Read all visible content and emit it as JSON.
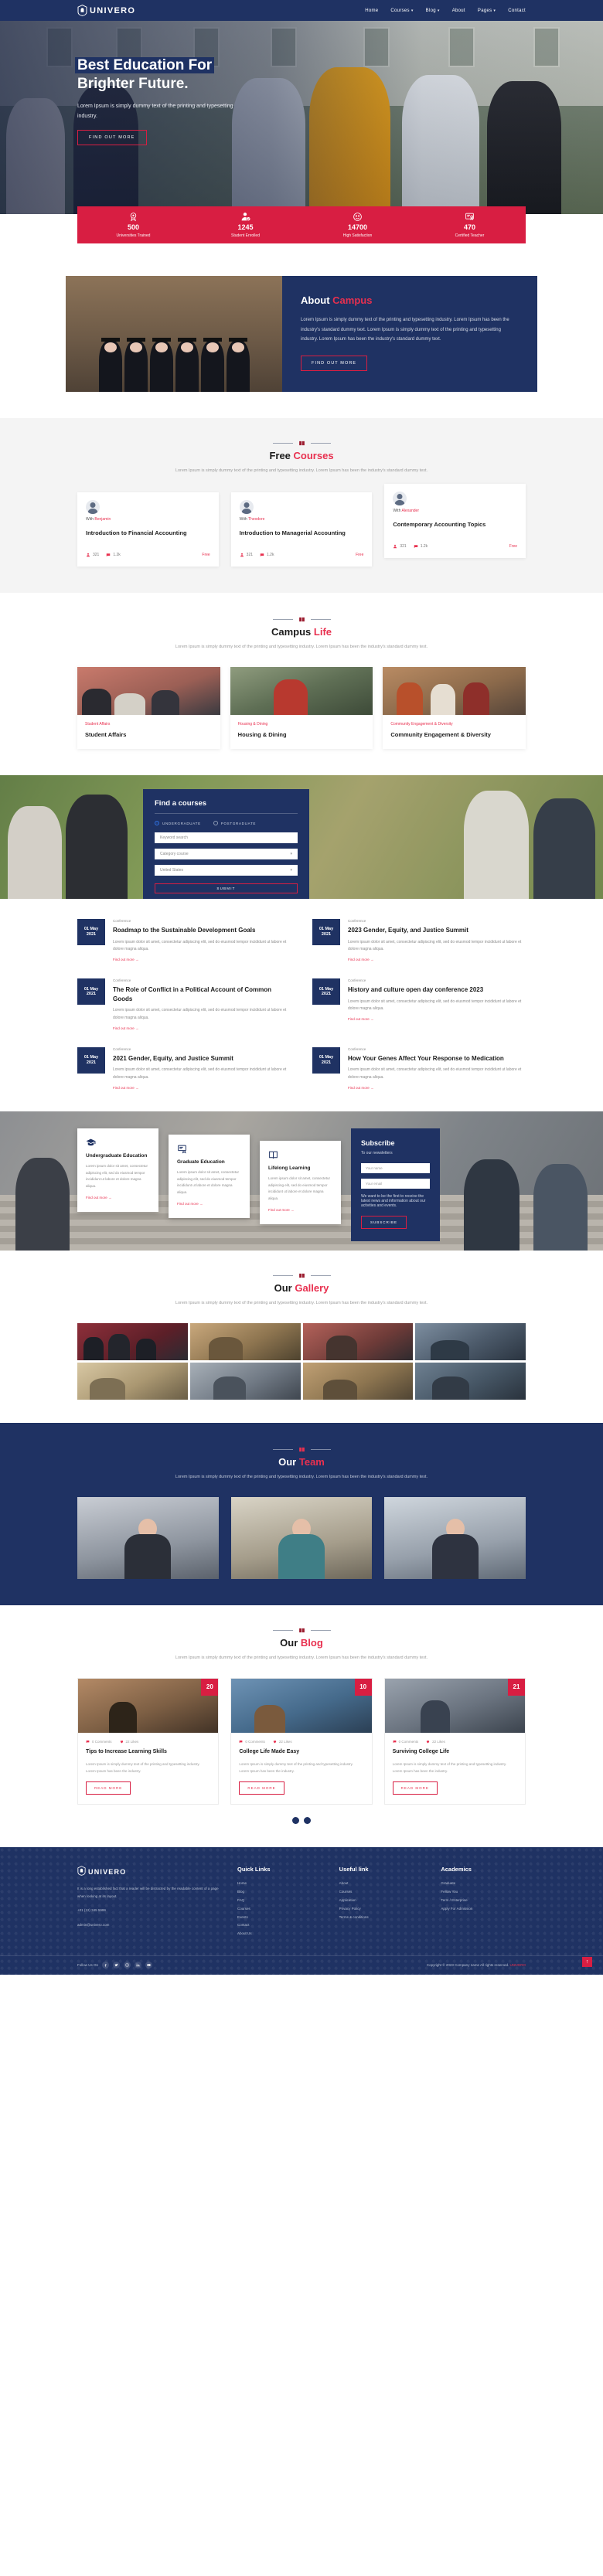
{
  "nav": {
    "brand": "UNIVERO",
    "links": [
      {
        "label": "Home",
        "caret": false
      },
      {
        "label": "Courses",
        "caret": true
      },
      {
        "label": "Blog",
        "caret": true
      },
      {
        "label": "About",
        "caret": false
      },
      {
        "label": "Pages",
        "caret": true
      },
      {
        "label": "Contact",
        "caret": false
      }
    ]
  },
  "hero": {
    "line1": "Best Education For",
    "line2": "Brighter Future.",
    "paragraph": "Lorem Ipsum is simply dummy text of the printing and typesetting industry.",
    "button": "FIND OUT MORE"
  },
  "stats": [
    {
      "icon": "award-badge-icon",
      "number": "500",
      "label": "Universities Trained"
    },
    {
      "icon": "verified-student-icon",
      "number": "1245",
      "label": "Student Enrolled"
    },
    {
      "icon": "smile-face-icon",
      "number": "14700",
      "label": "High Satisfaction"
    },
    {
      "icon": "certificate-icon",
      "number": "470",
      "label": "Certified Teacher"
    }
  ],
  "about": {
    "title_main": "About",
    "title_accent": "Campus",
    "paragraph": "Lorem Ipsum is simply dummy text of the printing and typesetting industry. Lorem Ipsum has been the industry's standard dummy text. Lorem Ipsum is simply dummy text of the printing and typesetting industry. Lorem Ipsum has been the industry's standard dummy text.",
    "button": "FIND OUT MORE"
  },
  "courses": {
    "title_main": "Free",
    "title_accent": "Courses",
    "subtitle": "Lorem Ipsum is simply dummy text of the printing and typesetting industry. Lorem Ipsum has been the industry's standard dummy text.",
    "items": [
      {
        "with_prefix": "With",
        "teacher": "Benjamin",
        "name": "Introduction to Financial Accounting",
        "students": "321",
        "views": "1.2k",
        "price": "Free"
      },
      {
        "with_prefix": "With",
        "teacher": "Theodore",
        "name": "Introduction to Managerial Accounting",
        "students": "321",
        "views": "1.2k",
        "price": "Free"
      },
      {
        "with_prefix": "With",
        "teacher": "Alexander",
        "name": "Contemporary Accounting Topics",
        "students": "321",
        "views": "1.2k",
        "price": "Free"
      }
    ]
  },
  "campus": {
    "title_main": "Campus",
    "title_accent": "Life",
    "subtitle": "Lorem Ipsum is simply dummy text of the printing and typesetting industry. Lorem Ipsum has been the industry's standard dummy text.",
    "items": [
      {
        "tag": "Student Affairs",
        "name": "Student Affairs"
      },
      {
        "tag": "Housing & Dining",
        "name": "Housing & Dining"
      },
      {
        "tag": "Community Engagement & Diversity",
        "name": "Community Engagement & Diversity"
      }
    ]
  },
  "finder": {
    "title": "Find a courses",
    "radio_undergrad": "UNDERGRADUATE",
    "radio_postgrad": "POSTGRADUATE",
    "keyword_placeholder": "Keyword search",
    "category_placeholder": "Category course",
    "country_placeholder": "United States",
    "submit": "SUBMIT"
  },
  "events": [
    {
      "day": "01 May",
      "year": "2021",
      "category": "Conference",
      "title": "Roadmap to the Sustainable Development Goals",
      "desc": "Lorem ipsum dolor sit amet, consectetur adipiscing elit, sed do eiusmod tempor incididunt ut labore et dolore magna aliqua.",
      "more": "Find out more →"
    },
    {
      "day": "01 May",
      "year": "2021",
      "category": "Conference",
      "title": "2023 Gender, Equity, and Justice Summit",
      "desc": "Lorem ipsum dolor sit amet, consectetur adipiscing elit, sed do eiusmod tempor incididunt ut labore et dolore magna aliqua.",
      "more": "Find out more →"
    },
    {
      "day": "01 May",
      "year": "2021",
      "category": "Conference",
      "title": "The Role of Conflict in a Political Account of Common Goods",
      "desc": "Lorem ipsum dolor sit amet, consectetur adipiscing elit, sed do eiusmod tempor incididunt ut labore et dolore magna aliqua.",
      "more": "Find out more →"
    },
    {
      "day": "01 May",
      "year": "2021",
      "category": "Conference",
      "title": "History and culture open day conference 2023",
      "desc": "Lorem ipsum dolor sit amet, consectetur adipiscing elit, sed do eiusmod tempor incididunt ut labore et dolore magna aliqua.",
      "more": "Find out more →"
    },
    {
      "day": "01 May",
      "year": "2021",
      "category": "Conference",
      "title": "2021 Gender, Equity, and Justice Summit",
      "desc": "Lorem ipsum dolor sit amet, consectetur adipiscing elit, sed do eiusmod tempor incididunt ut labore et dolore magna aliqua.",
      "more": "Find out more →"
    },
    {
      "day": "01 May",
      "year": "2021",
      "category": "Conference",
      "title": "How Your Genes Affect Your Response to Medication",
      "desc": "Lorem ipsum dolor sit amet, consectetur adipiscing elit, sed do eiusmod tempor incididunt ut labore et dolore magna aliqua.",
      "more": "Find out more →"
    }
  ],
  "admission": {
    "cards": [
      {
        "icon": "graduation-cap-icon",
        "title": "Undergraduate Education",
        "desc": "Lorem ipsum dolor sit amet, consectetur adipiscing elit, sed do eiusmod tempor incididunt ut labore et dolore magna aliqua.",
        "link": "Find out more →"
      },
      {
        "icon": "diploma-icon",
        "title": "Graduate Education",
        "desc": "Lorem ipsum dolor sit amet, consectetur adipiscing elit, sed do eiusmod tempor incididunt ut labore et dolore magna aliqua.",
        "link": "Find out more →"
      },
      {
        "icon": "book-icon",
        "title": "Lifelong Learning",
        "desc": "Lorem ipsum dolor sit amet, consectetur adipiscing elit, sed do eiusmod tempor incididunt ut labore et dolore magna aliqua.",
        "link": "Find out more →"
      }
    ],
    "newsletter": {
      "title": "Subscribe",
      "subtitle": "To our newsletters",
      "name_placeholder": "Your name",
      "email_placeholder": "Your email",
      "desc": "We want to be the first to receive the latest news and information about our activities and events.",
      "button": "SUBSCRIBE"
    }
  },
  "gallery": {
    "title_main": "Our",
    "title_accent": "Gallery",
    "subtitle": "Lorem Ipsum is simply dummy text of the printing and typesetting industry. Lorem Ipsum has been the industry's standard dummy text."
  },
  "team": {
    "title_main": "Our",
    "title_accent": "Team",
    "subtitle": "Lorem Ipsum is simply dummy text of the printing and typesetting industry. Lorem Ipsum has been the industry's standard dummy text."
  },
  "blog": {
    "title_main": "Our",
    "title_accent": "Blog",
    "subtitle": "Lorem Ipsum is simply dummy text of the printing and typesetting industry. Lorem Ipsum has been the industry's standard dummy text.",
    "posts": [
      {
        "badge": "20",
        "comments": "0 Comments",
        "likes": "22 Likes",
        "title": "Tips to Increase Learning Skills",
        "desc": "Lorem Ipsum is simply dummy text of the printing and typesetting industry. Lorem Ipsum has been the industry.",
        "button": "READ MORE"
      },
      {
        "badge": "10",
        "comments": "0 Comments",
        "likes": "22 Likes",
        "title": "College Life Made Easy",
        "desc": "Lorem Ipsum is simply dummy text of the printing and typesetting industry. Lorem Ipsum has been the industry.",
        "button": "READ MORE"
      },
      {
        "badge": "21",
        "comments": "0 Comments",
        "likes": "22 Likes",
        "title": "Surviving College Life",
        "desc": "Lorem Ipsum is simply dummy text of the printing and typesetting industry. Lorem Ipsum has been the industry.",
        "button": "READ MORE"
      }
    ]
  },
  "footer": {
    "brand": "UNIVERO",
    "about": "It is a long established fact that a reader will be distracted by the readable content of a page when looking at its layout.",
    "phone": "+01 (12) 345 5999",
    "email": "admin@univero.com",
    "quick_links_title": "Quick Links",
    "quick_links": [
      "Home",
      "Blog",
      "FAQ",
      "Courses",
      "Events",
      "Contact",
      "About Us"
    ],
    "useful_title": "Useful link",
    "useful": [
      "About",
      "Courses",
      "Application",
      "Privacy Policy",
      "Terms & conditions"
    ],
    "academics_title": "Academics",
    "academics": [
      "Graduate",
      "Fellow You",
      "Term / Enterprise",
      "Apply For Admission"
    ],
    "follow_label": "Follow Us On",
    "socials": [
      "facebook-icon",
      "twitter-icon",
      "instagram-icon",
      "linkedin-icon",
      "youtube-icon"
    ],
    "copyright_prefix": "Copyright © 2023 Company name All rights reserved.",
    "copyright_accent": "UNIVERO",
    "to_top": "↑"
  },
  "colors": {
    "navy": "#1f3263",
    "red": "#d81e42",
    "accent": "#e8304f"
  }
}
